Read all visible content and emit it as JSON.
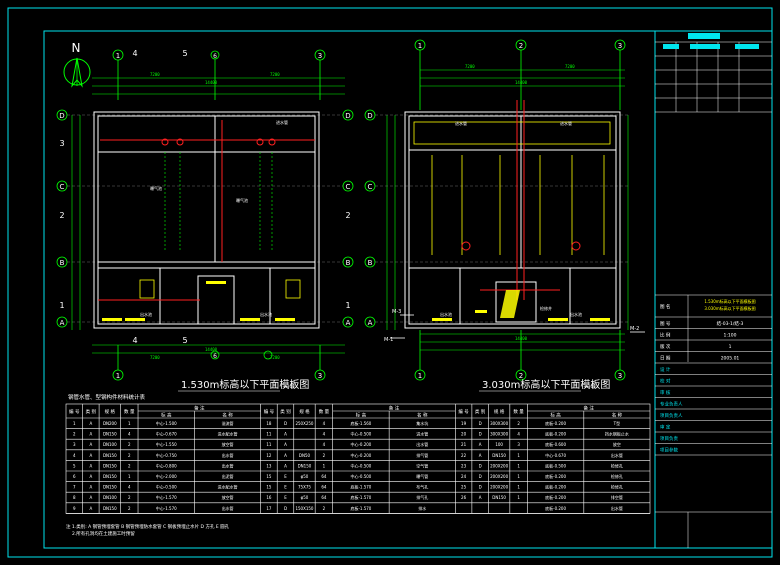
{
  "north": {
    "label": "N"
  },
  "left_plan": {
    "title": "1.530m标高以下平面模板图",
    "scale": "1:100",
    "col_labels": [
      "1",
      "4",
      "5",
      "6",
      "3"
    ],
    "row_labels": [
      "D",
      "C",
      "B",
      "A"
    ],
    "side_labels": [
      "3",
      "2",
      "1"
    ]
  },
  "right_plan": {
    "title": "3.030m标高以下平面模板图",
    "scale": "1:100",
    "col_labels": [
      "1",
      "2",
      "3"
    ],
    "row_labels": [
      "D",
      "C",
      "B",
      "A"
    ],
    "markers": [
      "M-1",
      "M-2",
      "M-3"
    ]
  },
  "table": {
    "caption": "钢管水管、型钢构件材料统计表",
    "headers": [
      "编 号",
      "类 别",
      "规 格",
      "数 量",
      "备 注"
    ],
    "subheaders": [
      "标 高",
      "名 称"
    ],
    "rows": [
      [
        "1",
        "A",
        "DN200",
        "1",
        "中心-1.500",
        "溢流管",
        "18",
        "D",
        "250X250",
        "4",
        "底板-1.560",
        "集水坑",
        "19",
        "D",
        "300X300",
        "2",
        "底板-0.200",
        "T型"
      ],
      [
        "2",
        "A",
        "DN150",
        "4",
        "中心-0.670",
        "进水配水管",
        "11",
        "A",
        "",
        "4",
        "中心-0.500",
        "进水管",
        "20",
        "D",
        "300X300",
        "4",
        "底板-0.200",
        "挡水钢板止水"
      ],
      [
        "3",
        "A",
        "DN100",
        "2",
        "中心-1.550",
        "放空管",
        "11",
        "A",
        "",
        "4",
        "中心-0.200",
        "出水管",
        "21",
        "A",
        "100",
        "3",
        "底板-0.600",
        "放空"
      ],
      [
        "4",
        "A",
        "DN150",
        "2",
        "中心-0.750",
        "出水管",
        "12",
        "A",
        "DN50",
        "2",
        "中心-0.200",
        "排气管",
        "22",
        "A",
        "DN150",
        "1",
        "中心-0.670",
        "出水管"
      ],
      [
        "5",
        "A",
        "DN150",
        "2",
        "中心-0.800",
        "出水管",
        "13",
        "A",
        "DN150",
        "1",
        "中心-0.500",
        "空气管",
        "23",
        "D",
        "200X200",
        "1",
        "底板-0.500",
        "检修孔"
      ],
      [
        "6",
        "A",
        "DN150",
        "1",
        "中心-2.000",
        "出泥管",
        "15",
        "E",
        "φ50",
        "64",
        "中心-0.500",
        "曝气管",
        "24",
        "D",
        "200X200",
        "1",
        "底板-0.200",
        "检修孔"
      ],
      [
        "7",
        "A",
        "DN150",
        "4",
        "中心-0.500",
        "进水配水管",
        "15",
        "E",
        "75X75",
        "64",
        "底板-1.570",
        "布气孔",
        "25",
        "D",
        "200X200",
        "1",
        "底板-0.200",
        "检修孔"
      ],
      [
        "8",
        "A",
        "DN100",
        "2",
        "中心-1.570",
        "放空管",
        "16",
        "E",
        "φ50",
        "64",
        "底板-1.570",
        "排气孔",
        "26",
        "A",
        "DN150",
        "1",
        "底板-0.200",
        "排空管"
      ],
      [
        "9",
        "A",
        "DN150",
        "2",
        "中心-1.570",
        "出水管",
        "17",
        "D",
        "150X150",
        "2",
        "底板-1.570",
        "排水",
        "",
        "",
        "",
        "",
        "底板-0.200",
        "出水管"
      ]
    ],
    "notes": [
      "注 1.类别: A 钢管预埋套管  B 钢管预埋防水套管  C 钢板预埋止水片  D 方孔  E 圆孔",
      "2.所有孔洞均在土建施工时预留"
    ]
  },
  "title_block": {
    "rows": [
      {
        "label": "图 名",
        "value": "1.530m标高以下平面模板图 3.030m标高以下平面模板图"
      },
      {
        "label": "图 号",
        "value": "结-03-1/结-3"
      },
      {
        "label": "比 例",
        "value": "1:100"
      },
      {
        "label": "版 次",
        "value": "1"
      },
      {
        "label": "日 期",
        "value": "2005.01"
      },
      {
        "label": "设 计",
        "value": ""
      },
      {
        "label": "校 对",
        "value": ""
      },
      {
        "label": "审 核",
        "value": ""
      },
      {
        "label": "专业负责人",
        "value": ""
      },
      {
        "label": "项目负责人",
        "value": ""
      },
      {
        "label": "审 定",
        "value": ""
      },
      {
        "label": "项目负责",
        "value": ""
      },
      {
        "label": "项目参数",
        "value": ""
      }
    ]
  },
  "colors": {
    "background": "#000000",
    "frame": "#00e5ee",
    "line": "#ffffff",
    "dim": "#00ff00",
    "red": "#ff2020",
    "yellow": "#ffff00",
    "magenta": "#ff00ff"
  }
}
